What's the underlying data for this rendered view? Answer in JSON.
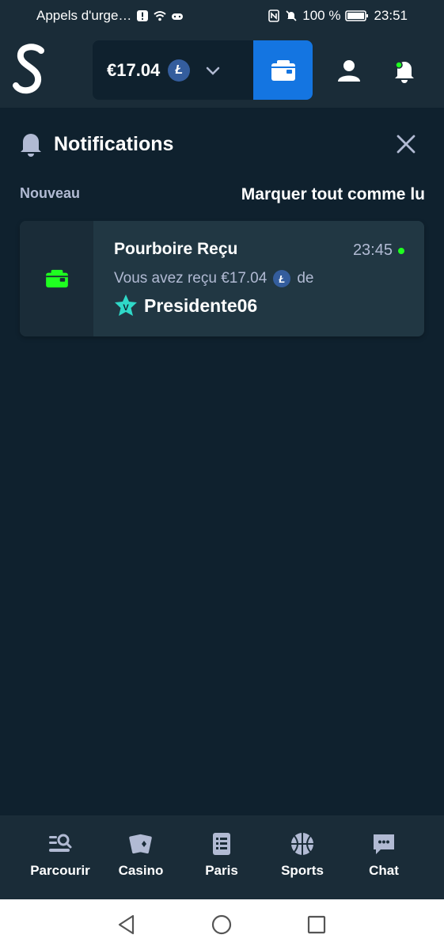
{
  "status_bar": {
    "carrier": "Appels d'urge…",
    "battery": "100 %",
    "time": "23:51"
  },
  "header": {
    "balance": "€17.04",
    "currency_symbol": "Ł",
    "colors": {
      "wallet": "#1475e1",
      "header_bg": "#1a2c38",
      "online_dot": "#1fff20"
    }
  },
  "notifications": {
    "title": "Notifications",
    "section_label": "Nouveau",
    "mark_all_label": "Marquer tout comme lu",
    "items": [
      {
        "title": "Pourboire Reçu",
        "time": "23:45",
        "body_prefix": "Vous avez reçu €17.04",
        "currency_symbol": "Ł",
        "body_suffix": "de",
        "vip_badge": "V",
        "user": "Presidente06"
      }
    ]
  },
  "bottom_nav": {
    "items": [
      {
        "label": "Parcourir",
        "icon": "browse-icon"
      },
      {
        "label": "Casino",
        "icon": "cards-icon"
      },
      {
        "label": "Paris",
        "icon": "list-icon"
      },
      {
        "label": "Sports",
        "icon": "basketball-icon"
      },
      {
        "label": "Chat",
        "icon": "chat-icon"
      }
    ]
  }
}
